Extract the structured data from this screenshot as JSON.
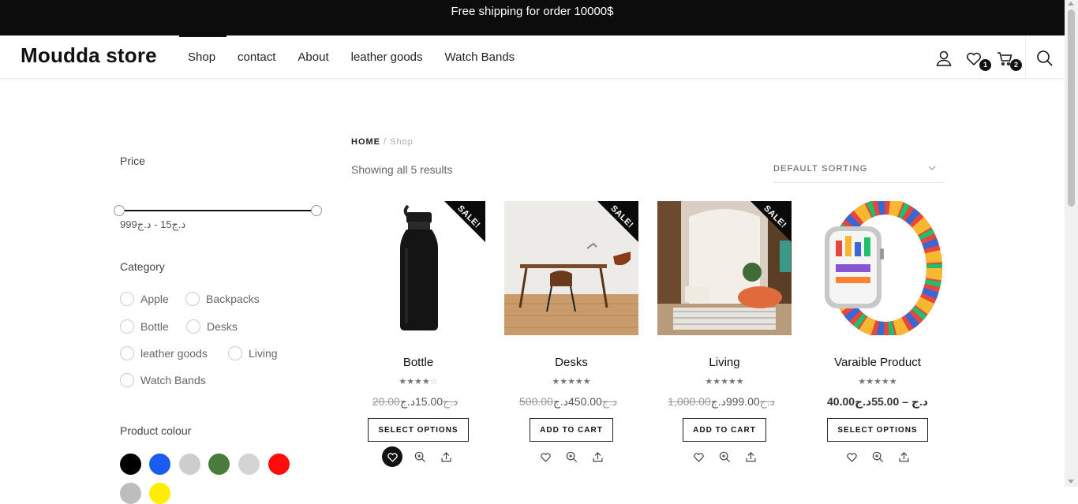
{
  "topbar": {
    "text": "Free shipping for order 10000$"
  },
  "header": {
    "logo": "Moudda store",
    "nav": [
      "Shop",
      "contact",
      "About",
      "leather goods",
      "Watch Bands"
    ],
    "wishlist_count": "1",
    "cart_count": "2"
  },
  "sidebar": {
    "price_title": "Price",
    "price_range": "د.ج15 - د.ج999",
    "category_title": "Category",
    "categories": [
      "Apple",
      "Backpacks",
      "Bottle",
      "Desks",
      "leather goods",
      "Living",
      "Watch Bands"
    ],
    "colour_title": "Product colour",
    "colours": [
      "#000000",
      "#1a5cf0",
      "#cfcccc",
      "#4a7a3c",
      "#d4d4d4",
      "#ff0c0c",
      "#bdbdbd",
      "#ffee00"
    ]
  },
  "main": {
    "crumb_home": "HOME",
    "crumb_sep": " / ",
    "crumb_current": "Shop",
    "result_count": "Showing all 5 results",
    "sort_label": "DEFAULT SORTING"
  },
  "products": [
    {
      "name": "Bottle",
      "sale": "SALE!",
      "old_price": "20.00د.ج",
      "new_price": "15.00د.ج",
      "button": "SELECT OPTIONS",
      "rating": 4,
      "image": "black-bottle"
    },
    {
      "name": "Desks",
      "sale": "SALE!",
      "old_price": "500.00د.ج",
      "new_price": "450.00د.ج",
      "button": "ADD TO CART",
      "rating": 5,
      "image": "desk-room"
    },
    {
      "name": "Living",
      "sale": "SALE!",
      "old_price": "1,000.00د.ج",
      "new_price": "999.00د.ج",
      "button": "ADD TO CART",
      "rating": 5,
      "image": "living-room"
    },
    {
      "name": "Varaible Product",
      "price_range": "40.00د.ج – 55.00د.ج",
      "button": "SELECT OPTIONS",
      "rating": 5,
      "image": "watch-band"
    }
  ],
  "colors": {
    "topbar": "#0c0c0c",
    "accent": "#111111"
  }
}
